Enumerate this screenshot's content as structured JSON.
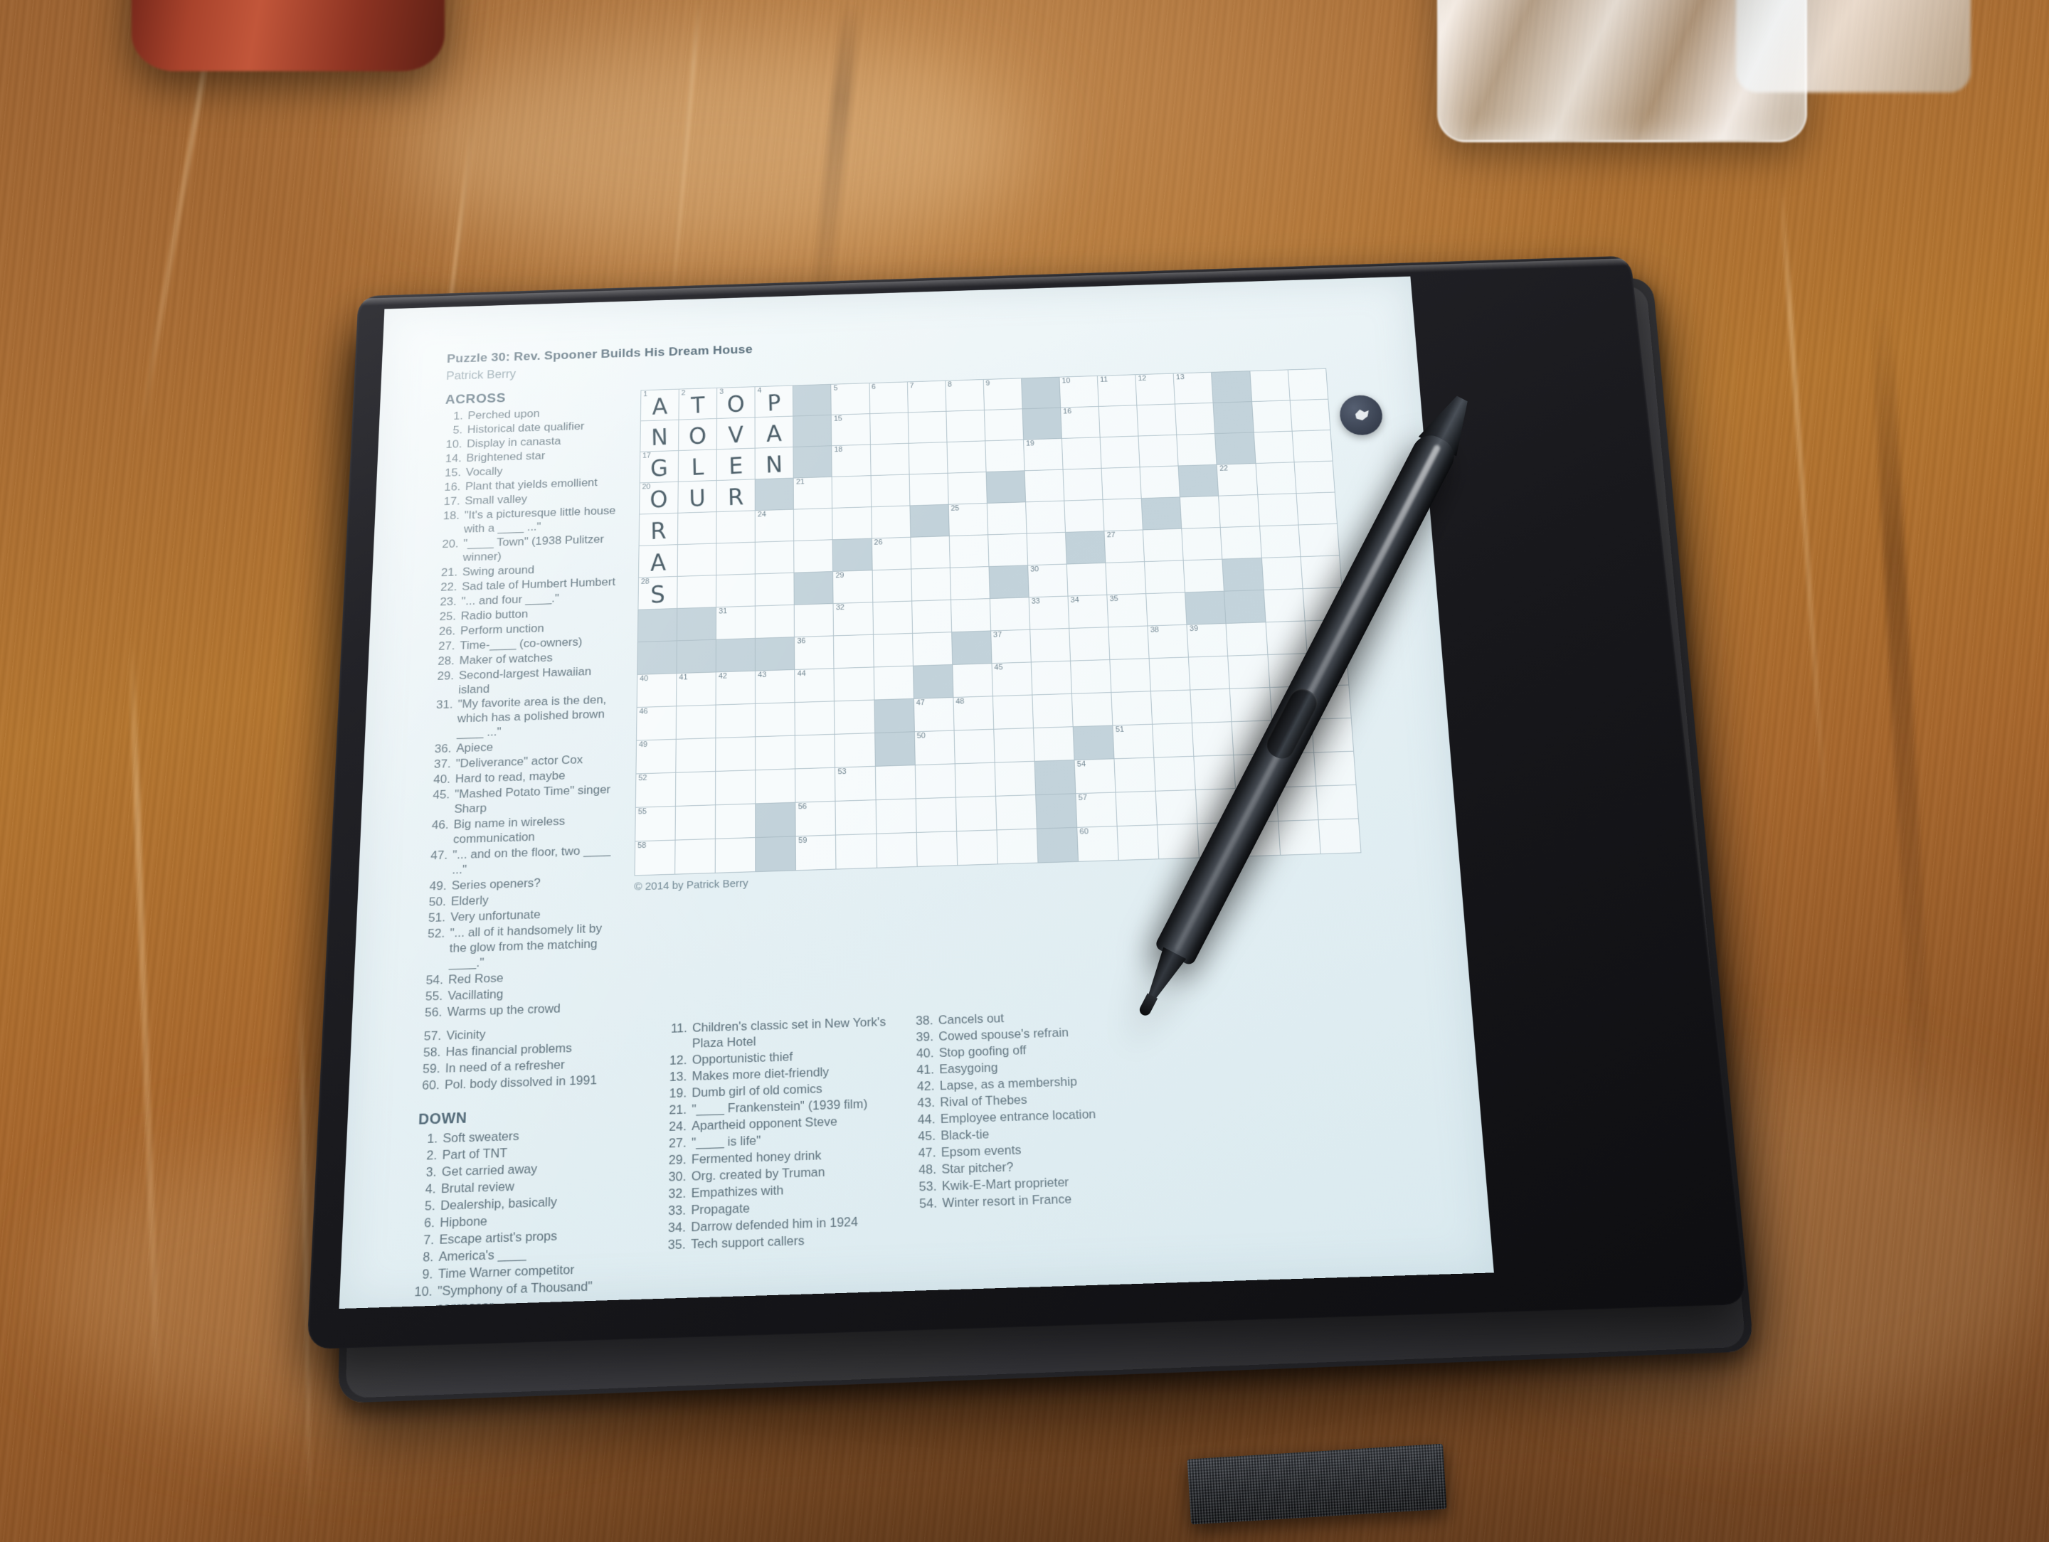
{
  "document": {
    "title": "Puzzle 30: Rev. Spooner Builds His Dream House",
    "author": "Patrick Berry",
    "copyright": "© 2014 by Patrick Berry",
    "across_heading": "ACROSS",
    "down_heading": "DOWN"
  },
  "device": {
    "floating_button_icon": "assistant-flower-icon"
  },
  "clues": {
    "across_col1": [
      {
        "num": "1.",
        "text": "Perched upon"
      },
      {
        "num": "5.",
        "text": "Historical date qualifier"
      },
      {
        "num": "10.",
        "text": "Display in canasta"
      },
      {
        "num": "14.",
        "text": "Brightened star"
      },
      {
        "num": "15.",
        "text": "Vocally"
      },
      {
        "num": "16.",
        "text": "Plant that yields emollient"
      },
      {
        "num": "17.",
        "text": "Small valley"
      },
      {
        "num": "18.",
        "text": "\"It's a picturesque little house with a ____ ...\""
      },
      {
        "num": "20.",
        "text": "\"____ Town\" (1938 Pulitzer winner)"
      },
      {
        "num": "21.",
        "text": "Swing around"
      },
      {
        "num": "22.",
        "text": "Sad tale of Humbert Humbert"
      },
      {
        "num": "23.",
        "text": "\"... and four ____.\""
      },
      {
        "num": "25.",
        "text": "Radio button"
      },
      {
        "num": "26.",
        "text": "Perform unction"
      },
      {
        "num": "27.",
        "text": "Time-____ (co-owners)"
      },
      {
        "num": "28.",
        "text": "Maker of watches"
      },
      {
        "num": "29.",
        "text": "Second-largest Hawaiian island"
      },
      {
        "num": "31.",
        "text": "\"My favorite area is the den, which has a polished brown ____ ...\""
      },
      {
        "num": "36.",
        "text": "Apiece"
      },
      {
        "num": "37.",
        "text": "\"Deliverance\" actor Cox"
      },
      {
        "num": "40.",
        "text": "Hard to read, maybe"
      },
      {
        "num": "45.",
        "text": "\"Mashed Potato Time\" singer Sharp"
      },
      {
        "num": "46.",
        "text": "Big name in wireless communication"
      },
      {
        "num": "47.",
        "text": "\"... and on the floor, two ____ ...\""
      },
      {
        "num": "49.",
        "text": "Series openers?"
      },
      {
        "num": "50.",
        "text": "Elderly"
      },
      {
        "num": "51.",
        "text": "Very unfortunate"
      },
      {
        "num": "52.",
        "text": "\"... all of it handsomely lit by the glow from the matching ____.\""
      },
      {
        "num": "54.",
        "text": "Red Rose"
      },
      {
        "num": "55.",
        "text": "Vacillating"
      },
      {
        "num": "56.",
        "text": "Warms up the crowd"
      }
    ],
    "across_col2": [
      {
        "num": "57.",
        "text": "Vicinity"
      },
      {
        "num": "58.",
        "text": "Has financial problems"
      },
      {
        "num": "59.",
        "text": "In need of a refresher"
      },
      {
        "num": "60.",
        "text": "Pol. body dissolved in 1991"
      }
    ],
    "down_col2": [
      {
        "num": "1.",
        "text": "Soft sweaters"
      },
      {
        "num": "2.",
        "text": "Part of TNT"
      },
      {
        "num": "3.",
        "text": "Get carried away"
      },
      {
        "num": "4.",
        "text": "Brutal review"
      },
      {
        "num": "5.",
        "text": "Dealership, basically"
      },
      {
        "num": "6.",
        "text": "Hipbone"
      },
      {
        "num": "7.",
        "text": "Escape artist's props"
      },
      {
        "num": "8.",
        "text": "America's ____"
      },
      {
        "num": "9.",
        "text": "Time Warner competitor"
      },
      {
        "num": "10.",
        "text": "\"Symphony of a Thousand\" composer"
      }
    ],
    "down_col3": [
      {
        "num": "11.",
        "text": "Children's classic set in New York's Plaza Hotel"
      },
      {
        "num": "12.",
        "text": "Opportunistic thief"
      },
      {
        "num": "13.",
        "text": "Makes more diet-friendly"
      },
      {
        "num": "19.",
        "text": "Dumb girl of old comics"
      },
      {
        "num": "21.",
        "text": "\"____ Frankenstein\" (1939 film)"
      },
      {
        "num": "24.",
        "text": "Apartheid opponent Steve"
      },
      {
        "num": "27.",
        "text": "\"____ is life\""
      },
      {
        "num": "29.",
        "text": "Fermented honey drink"
      },
      {
        "num": "30.",
        "text": "Org. created by Truman"
      },
      {
        "num": "32.",
        "text": "Empathizes with"
      },
      {
        "num": "33.",
        "text": "Propagate"
      },
      {
        "num": "34.",
        "text": "Darrow defended him in 1924"
      },
      {
        "num": "35.",
        "text": "Tech support callers"
      }
    ],
    "down_col4": [
      {
        "num": "38.",
        "text": "Cancels out"
      },
      {
        "num": "39.",
        "text": "Cowed spouse's refrain"
      },
      {
        "num": "40.",
        "text": "Stop goofing off"
      },
      {
        "num": "41.",
        "text": "Easygoing"
      },
      {
        "num": "42.",
        "text": "Lapse, as a membership"
      },
      {
        "num": "43.",
        "text": "Rival of Thebes"
      },
      {
        "num": "44.",
        "text": "Employee entrance location"
      },
      {
        "num": "45.",
        "text": "Black-tie"
      },
      {
        "num": "47.",
        "text": "Epsom events"
      },
      {
        "num": "48.",
        "text": "Star pitcher?"
      },
      {
        "num": "53.",
        "text": "Kwik-E-Mart proprieter"
      },
      {
        "num": "54.",
        "text": "Winter resort in France"
      }
    ]
  },
  "grid": {
    "cols": 18,
    "rows": 13,
    "filled_answers": {
      "1_across": "ATOP",
      "14_across": "NOVA",
      "17_across": "GLEN",
      "20_across_partial": "OUR",
      "1_down": "ANGORAS"
    },
    "cells": [
      [
        {
          "n": "1",
          "l": "A"
        },
        {
          "n": "2",
          "l": "T"
        },
        {
          "n": "3",
          "l": "O"
        },
        {
          "n": "4",
          "l": "P"
        },
        {
          "s": 1
        },
        {
          "n": "5"
        },
        {
          "n": "6"
        },
        {
          "n": "7"
        },
        {
          "n": "8"
        },
        {
          "n": "9"
        },
        {
          "s": 1
        },
        {
          "n": "10"
        },
        {
          "n": "11"
        },
        {
          "n": "12"
        },
        {
          "n": "13"
        },
        {
          "s": 1
        },
        {},
        {}
      ],
      [
        {
          "l": "N"
        },
        {
          "l": "O"
        },
        {
          "l": "V"
        },
        {
          "l": "A"
        },
        {
          "s": 1
        },
        {
          "n": "15"
        },
        {},
        {},
        {},
        {},
        {
          "s": 1
        },
        {
          "n": "16"
        },
        {},
        {},
        {},
        {
          "s": 1
        },
        {},
        {}
      ],
      [
        {
          "n": "17",
          "l": "G"
        },
        {
          "l": "L"
        },
        {
          "l": "E"
        },
        {
          "l": "N"
        },
        {
          "s": 1
        },
        {
          "n": "18"
        },
        {},
        {},
        {},
        {},
        {
          "n": "19"
        },
        {},
        {},
        {},
        {},
        {
          "s": 1
        },
        {},
        {}
      ],
      [
        {
          "n": "20",
          "l": "O"
        },
        {
          "l": "U"
        },
        {
          "l": "R"
        },
        {
          "s": 1
        },
        {
          "n": "21"
        },
        {},
        {},
        {},
        {},
        {
          "s": 1
        },
        {},
        {},
        {},
        {},
        {
          "s": 1
        },
        {
          "n": "22"
        },
        {},
        {}
      ],
      [
        {
          "l": "R"
        },
        {},
        {},
        {
          "n": "24"
        },
        {},
        {},
        {},
        {
          "s": 1
        },
        {
          "n": "25"
        },
        {},
        {},
        {},
        {},
        {
          "s": 1
        },
        {},
        {},
        {},
        {}
      ],
      [
        {
          "l": "A"
        },
        {},
        {},
        {},
        {},
        {
          "s": 1
        },
        {
          "n": "26"
        },
        {},
        {},
        {},
        {},
        {
          "s": 1
        },
        {
          "n": "27"
        },
        {},
        {},
        {},
        {},
        {}
      ],
      [
        {
          "n": "28",
          "l": "S"
        },
        {},
        {},
        {},
        {
          "s": 1
        },
        {
          "n": "29"
        },
        {},
        {},
        {},
        {
          "s": 1
        },
        {
          "n": "30"
        },
        {},
        {},
        {},
        {},
        {
          "s": 1
        },
        {},
        {}
      ],
      [
        {
          "s": 1
        },
        {
          "s": 1
        },
        {
          "n": "31"
        },
        {},
        {},
        {
          "n": "32"
        },
        {},
        {},
        {},
        {},
        {
          "n": "33"
        },
        {
          "n": "34"
        },
        {
          "n": "35"
        },
        {},
        {
          "s": 1
        },
        {
          "s": 1
        },
        {},
        {}
      ],
      [
        {
          "s": 1
        },
        {
          "s": 1
        },
        {
          "s": 1
        },
        {
          "s": 1
        },
        {
          "n": "36"
        },
        {},
        {},
        {},
        {
          "s": 1
        },
        {
          "n": "37"
        },
        {},
        {},
        {},
        {
          "n": "38"
        },
        {
          "n": "39"
        },
        {},
        {},
        {}
      ],
      [
        {
          "n": "40"
        },
        {
          "n": "41"
        },
        {
          "n": "42"
        },
        {
          "n": "43"
        },
        {
          "n": "44"
        },
        {},
        {},
        {
          "s": 1
        },
        {},
        {
          "n": "45"
        },
        {},
        {},
        {},
        {},
        {},
        {},
        {},
        {}
      ],
      [
        {
          "n": "46"
        },
        {},
        {},
        {},
        {},
        {},
        {
          "s": 1
        },
        {
          "n": "47"
        },
        {
          "n": "48"
        },
        {},
        {},
        {},
        {},
        {},
        {},
        {},
        {},
        {}
      ],
      [
        {
          "n": "49"
        },
        {},
        {},
        {},
        {},
        {},
        {
          "s": 1
        },
        {
          "n": "50"
        },
        {},
        {},
        {},
        {
          "s": 1
        },
        {
          "n": "51"
        },
        {},
        {},
        {},
        {},
        {}
      ],
      [
        {
          "n": "52"
        },
        {},
        {},
        {},
        {},
        {
          "n": "53"
        },
        {},
        {},
        {},
        {},
        {
          "s": 1
        },
        {
          "n": "54"
        },
        {},
        {},
        {},
        {},
        {},
        {}
      ],
      [
        {
          "n": "55"
        },
        {},
        {},
        {
          "s": 1
        },
        {
          "n": "56"
        },
        {},
        {},
        {},
        {},
        {},
        {
          "s": 1
        },
        {
          "n": "57"
        },
        {},
        {},
        {},
        {},
        {},
        {}
      ],
      [
        {
          "n": "58"
        },
        {},
        {},
        {
          "s": 1
        },
        {
          "n": "59"
        },
        {},
        {},
        {},
        {},
        {},
        {
          "s": 1
        },
        {
          "n": "60"
        },
        {},
        {},
        {},
        {},
        {},
        {}
      ]
    ]
  }
}
